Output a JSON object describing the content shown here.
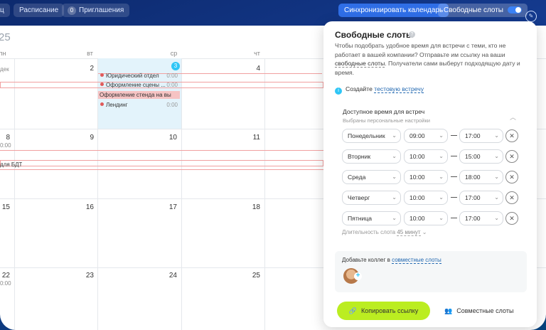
{
  "topbar": {
    "left_partial": "ц",
    "schedule": "Расписание",
    "invites_count": "0",
    "invites": "Приглашения",
    "sync": "Синхронизировать календарь",
    "free_slots": "Свободные слоты"
  },
  "calendar": {
    "year_partial": "25",
    "dow": [
      "пн",
      "вт",
      "ср",
      "чт"
    ],
    "week1_left_text": "дек",
    "days": [
      "2",
      "3",
      "4",
      "8",
      "9",
      "10",
      "11",
      "15",
      "16",
      "17",
      "18",
      "22",
      "23",
      "24",
      "25"
    ],
    "events": {
      "e1": "Юридический отдел",
      "e1_time": "0:00",
      "e2": "Оформление сцены ...",
      "e2_time": "0:00",
      "e3": "Оформление стенда на вы",
      "e4": "Лендинг",
      "e4_time": "0:00",
      "w2_left_time": "0:00",
      "w2_bdt": "для БДТ",
      "w4_left_time": "0:00"
    }
  },
  "panel": {
    "title": "Свободные слоты",
    "desc_a": "Чтобы подобрать удобное время для встречи с теми, кто не работает в вашей компании? Отправьте им ссылку на ваши",
    "desc_link": "свободные слоты",
    "desc_b": ". Получатели сами выберут подходящую дату и время.",
    "create_text": "Создайте",
    "create_link": "тестовую встречу",
    "available_title": "Доступное время для встреч",
    "available_sub": "Выбраны персональные настройки",
    "schedule": [
      {
        "day": "Понедельник",
        "from": "09:00",
        "to": "17:00"
      },
      {
        "day": "Вторник",
        "from": "10:00",
        "to": "15:00"
      },
      {
        "day": "Среда",
        "from": "10:00",
        "to": "18:00"
      },
      {
        "day": "Четверг",
        "from": "10:00",
        "to": "17:00"
      },
      {
        "day": "Пятница",
        "from": "10:00",
        "to": "17:00"
      }
    ],
    "duration_label": "Длительность слота",
    "duration_value": "45 минут",
    "colleagues_text": "Добавьте коллег в",
    "colleagues_link": "совместные слоты",
    "copy_button": "Копировать ссылку",
    "joint_button": "Совместные слоты"
  },
  "colors": {
    "accent_green": "#bbed21",
    "accent_blue": "#2fc6f6",
    "link_blue": "#2067b0"
  }
}
